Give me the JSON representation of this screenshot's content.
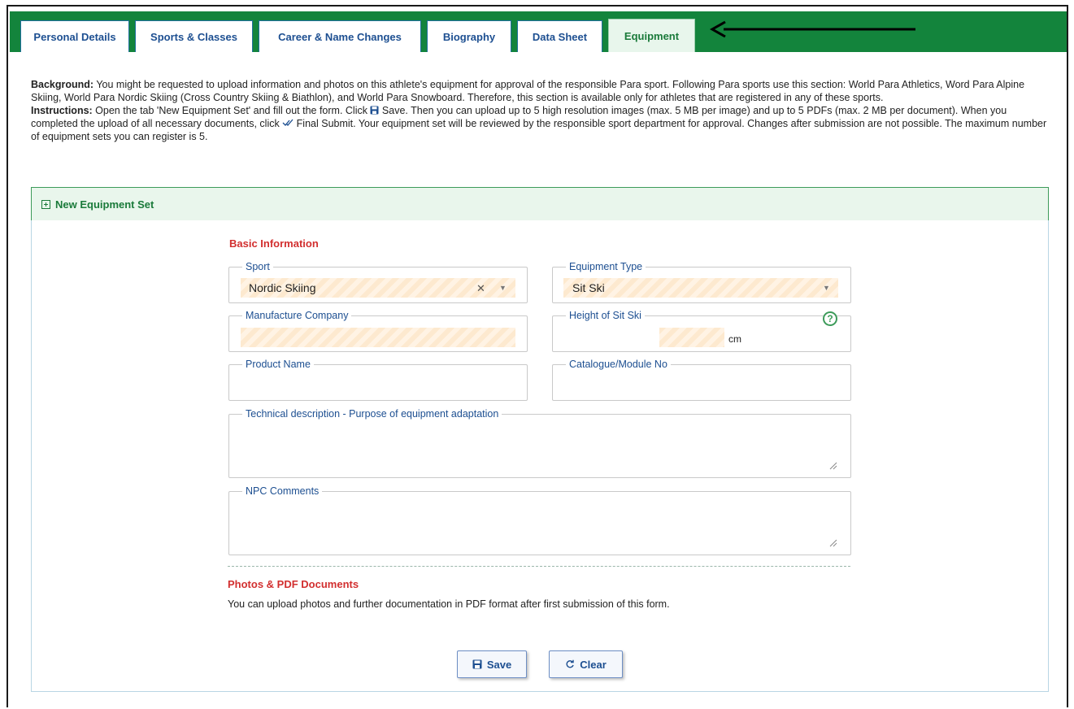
{
  "tabs": [
    {
      "label": "Personal Details"
    },
    {
      "label": "Sports & Classes"
    },
    {
      "label": "Career & Name Changes"
    },
    {
      "label": "Biography"
    },
    {
      "label": "Data Sheet"
    },
    {
      "label": "Equipment"
    }
  ],
  "active_tab": "Equipment",
  "intro": {
    "background_label": "Background:",
    "background_text": " You might be requested to upload information and photos on this athlete's equipment for approval of the responsible Para sport. Following Para sports use this section: World Para Athletics, Word Para Alpine Skiing, World Para Nordic Skiing (Cross Country Skiing & Biathlon), and World Para Snowboard. Therefore, this section is available only for athletes that are registered in any of these sports.",
    "instructions_label": "Instructions:",
    "instructions_part1": " Open the tab 'New Equipment Set' and fill out the form. Click ",
    "instructions_save": " Save. Then you can upload up to 5 high resolution images (max. 5 MB per image) and up to 5 PDFs (max. 2 MB per document). When you completed the upload of all necessary documents, click ",
    "instructions_part2": " Final Submit. Your equipment set will be reviewed by the responsible sport department for approval. Changes after submission are not possible. The maximum number of equipment sets you can register is 5."
  },
  "panel": {
    "title": "New Equipment Set"
  },
  "form": {
    "basic_info_title": "Basic Information",
    "sport": {
      "label": "Sport",
      "value": "Nordic Skiing",
      "clear_glyph": "✕",
      "caret_glyph": "▼"
    },
    "equipment_type": {
      "label": "Equipment Type",
      "value": "Sit Ski",
      "caret_glyph": "▼"
    },
    "manufacture_company": {
      "label": "Manufacture Company",
      "value": ""
    },
    "height_of_sit_ski": {
      "label": "Height of Sit Ski",
      "value": "",
      "unit": "cm",
      "help_glyph": "?"
    },
    "product_name": {
      "label": "Product Name",
      "value": ""
    },
    "catalogue_no": {
      "label": "Catalogue/Module No",
      "value": ""
    },
    "technical_description": {
      "label": "Technical description - Purpose of equipment adaptation",
      "value": ""
    },
    "npc_comments": {
      "label": "NPC Comments",
      "value": ""
    },
    "photos_title": "Photos & PDF Documents",
    "photos_note": "You can upload photos and further documentation in PDF format after first submission of this form."
  },
  "buttons": {
    "save": "Save",
    "clear": "Clear"
  },
  "colors": {
    "tabbar_green": "#13843c",
    "tab_text": "#1d4f91",
    "section_red": "#d22f2f",
    "panel_green": "#1a7a3a",
    "required_fill": "#fde9cf"
  },
  "icons": {
    "save_icon": "floppy-disk-icon",
    "clear_icon": "refresh-icon",
    "final_submit_icon": "double-check-icon",
    "panel_toggle_icon": "plus-square-icon"
  }
}
